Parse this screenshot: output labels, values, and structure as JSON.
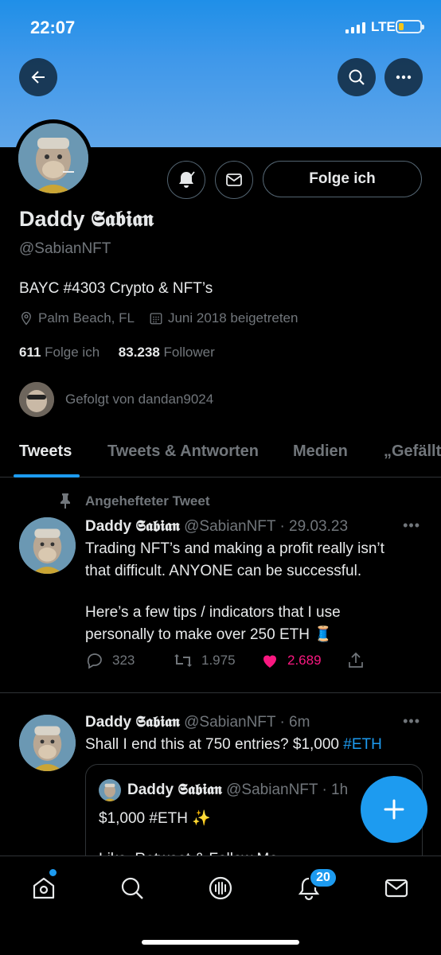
{
  "status_bar": {
    "time": "22:07",
    "network": "LTE"
  },
  "profile": {
    "name_plain": "Daddy ",
    "name_gothic": "𝕾𝖆𝖇𝖎𝖆𝖓",
    "handle": "@SabianNFT",
    "bio": "BAYC #4303 Crypto & NFT’s",
    "location": "Palm Beach, FL",
    "joined": "Juni 2018 beigetreten",
    "following_count": "611",
    "following_label": "Folge ich",
    "followers_count": "83.238",
    "followers_label": "Follower",
    "followed_by": "Gefolgt von dandan9024",
    "follow_button": "Folge ich"
  },
  "tabs": [
    {
      "label": "Tweets"
    },
    {
      "label": "Tweets & Antworten"
    },
    {
      "label": "Medien"
    },
    {
      "label": "„Gefällt"
    }
  ],
  "tweets": [
    {
      "pinned_label": "Angehefteter Tweet",
      "handle_date": "@SabianNFT · 29.03.23",
      "line1": "Trading NFT’s and making a profit really isn’t",
      "line2": "that difficult. ANYONE can be successful.",
      "line3": "Here’s a few tips / indicators that I use",
      "line4": "personally to make over 250 ETH 🧵",
      "replies": "323",
      "retweets": "1.975",
      "likes": "2.689"
    },
    {
      "handle_date": "@SabianNFT · 6m",
      "text_before": "Shall I end this at 750 entries? $1,000 ",
      "hashtag": "#ETH",
      "quote": {
        "handle_date": "@SabianNFT · 1h",
        "line1": "$1,000 #ETH ✨",
        "line2": "Like, Retweet & Follow Me"
      }
    }
  ],
  "bottom_nav": {
    "notifications_badge": "20"
  },
  "colors": {
    "accent": "#1d9bf0",
    "like": "#f91880",
    "muted": "#71767b",
    "banner": "#4a9cea"
  }
}
